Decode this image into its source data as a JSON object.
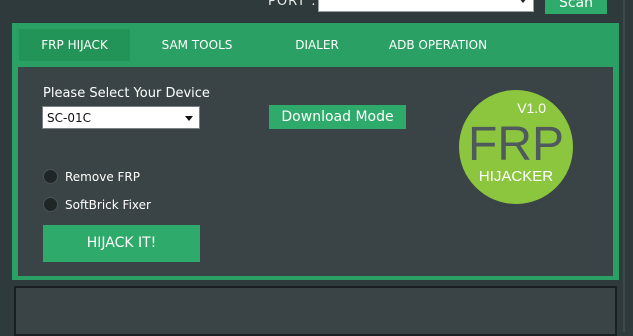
{
  "header": {
    "port_label": "PORT :",
    "scan_label": "Scan"
  },
  "tabs": [
    {
      "label": "FRP HIJACK",
      "active": true
    },
    {
      "label": "SAM TOOLS",
      "active": false
    },
    {
      "label": "DIALER",
      "active": false
    },
    {
      "label": "ADB OPERATION",
      "active": false
    }
  ],
  "frp_panel": {
    "select_label": "Please Select Your Device",
    "device_value": "SC-01C",
    "download_mode_label": "Download Mode",
    "options": [
      {
        "label": "Remove FRP"
      },
      {
        "label": "SoftBrick Fixer"
      }
    ],
    "hijack_label": "HIJACK IT!"
  },
  "logo": {
    "version": "V1.0",
    "title": "FRP",
    "subtitle": "HIJACKER"
  },
  "colors": {
    "accent_green": "#2eaa6a",
    "panel_dark": "#3a4446",
    "background": "#2f3a3c"
  }
}
